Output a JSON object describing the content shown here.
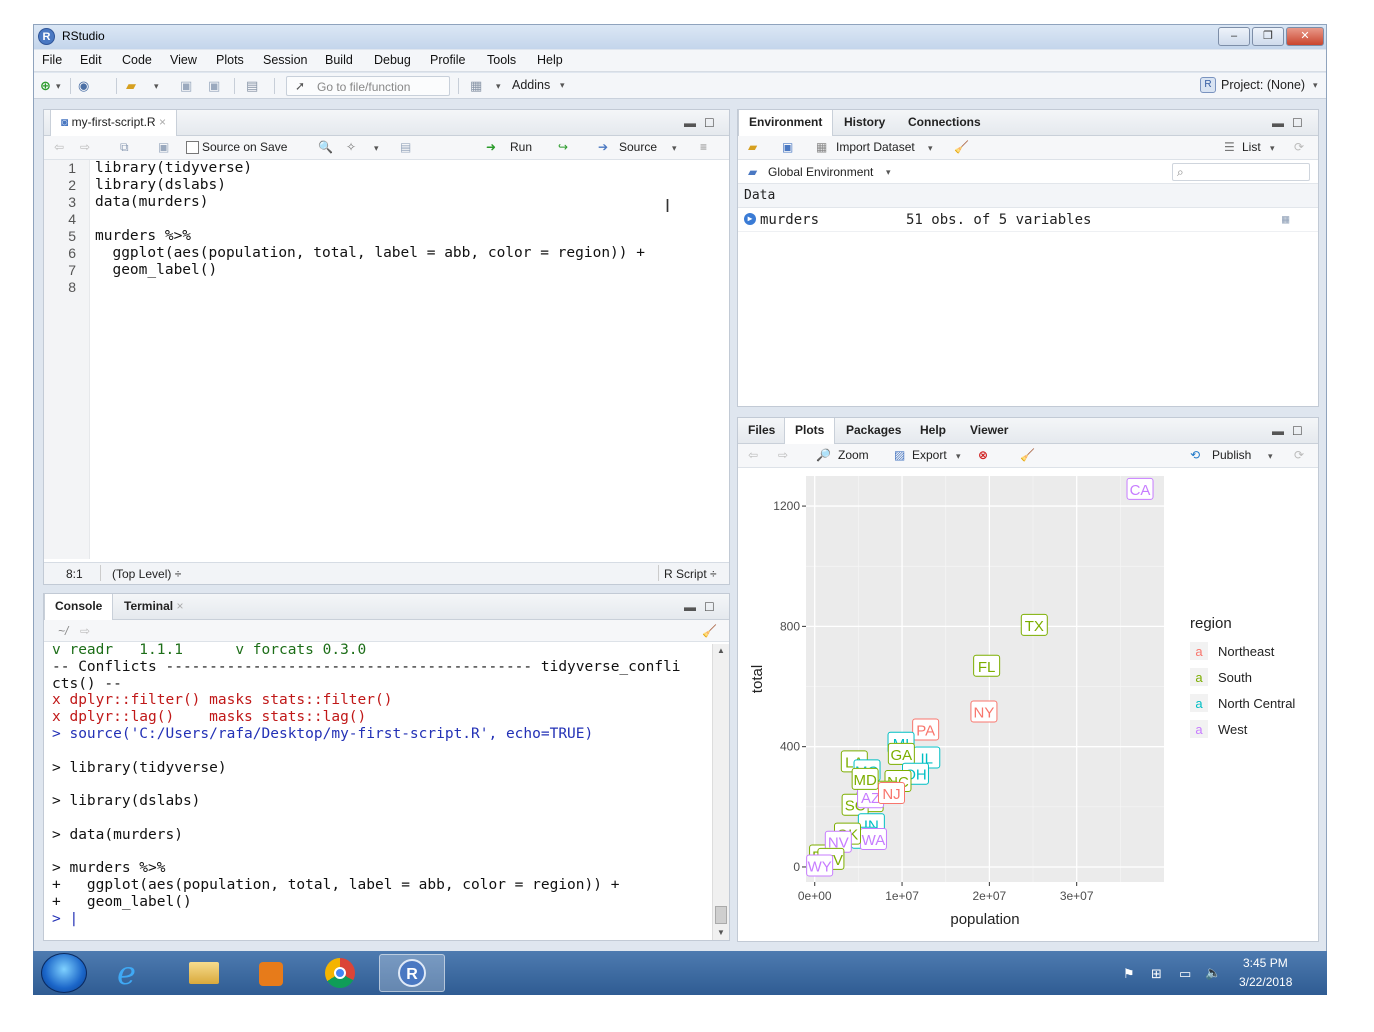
{
  "window": {
    "title": "RStudio"
  },
  "menu": [
    "File",
    "Edit",
    "Code",
    "View",
    "Plots",
    "Session",
    "Build",
    "Debug",
    "Profile",
    "Tools",
    "Help"
  ],
  "toolbar": {
    "goto_placeholder": "Go to file/function",
    "addins": "Addins",
    "project": "Project: (None)"
  },
  "editor": {
    "tab": "my-first-script.R",
    "source_on_save": "Source on Save",
    "run": "Run",
    "source": "Source",
    "lines": [
      "library(tidyverse)",
      "library(dslabs)",
      "data(murders)",
      "",
      "murders %>%",
      "  ggplot(aes(population, total, label = abb, color = region)) +",
      "  geom_label()",
      ""
    ],
    "line_numbers": [
      "1",
      "2",
      "3",
      "4",
      "5",
      "6",
      "7",
      "8"
    ],
    "status_pos": "8:1",
    "status_level": "(Top Level) ÷",
    "status_type": "R Script ÷"
  },
  "console": {
    "tabs": [
      "Console",
      "Terminal"
    ],
    "path": "~/",
    "lines": [
      {
        "t": "v readr   1.1.1      v forcats 0.3.0",
        "c": "cgreen"
      },
      {
        "t": "-- Conflicts ------------------------------------------ tidyverse_confli",
        "c": ""
      },
      {
        "t": "cts() --",
        "c": ""
      },
      {
        "t": "x dplyr::filter() masks stats::filter()",
        "c": "cred"
      },
      {
        "t": "x dplyr::lag()    masks stats::lag()",
        "c": "cred"
      },
      {
        "t": "> source('C:/Users/rafa/Desktop/my-first-script.R', echo=TRUE)",
        "c": "cblue"
      },
      {
        "t": "",
        "c": ""
      },
      {
        "t": "> library(tidyverse)",
        "c": ""
      },
      {
        "t": "",
        "c": ""
      },
      {
        "t": "> library(dslabs)",
        "c": ""
      },
      {
        "t": "",
        "c": ""
      },
      {
        "t": "> data(murders)",
        "c": ""
      },
      {
        "t": "",
        "c": ""
      },
      {
        "t": "> murders %>%",
        "c": ""
      },
      {
        "t": "+   ggplot(aes(population, total, label = abb, color = region)) +",
        "c": ""
      },
      {
        "t": "+   geom_label()",
        "c": ""
      },
      {
        "t": "> |",
        "c": "cblue"
      }
    ]
  },
  "environment": {
    "tabs": [
      "Environment",
      "History",
      "Connections"
    ],
    "import_dataset": "Import Dataset",
    "view_mode": "List",
    "scope": "Global Environment",
    "section": "Data",
    "rows": [
      {
        "name": "murders",
        "value": "51 obs. of 5 variables"
      }
    ]
  },
  "files_pane": {
    "tabs": [
      "Files",
      "Plots",
      "Packages",
      "Help",
      "Viewer"
    ],
    "zoom": "Zoom",
    "export": "Export",
    "publish": "Publish"
  },
  "colors": {
    "Northeast": "#F8766D",
    "South": "#7CAE00",
    "North Central": "#00BFC4",
    "West": "#C77CFF"
  },
  "chart_data": {
    "type": "scatter",
    "xlabel": "population",
    "ylabel": "total",
    "xlim": [
      -1000000,
      40000000
    ],
    "ylim": [
      -50,
      1300
    ],
    "xticks": [
      0,
      10000000,
      20000000,
      30000000
    ],
    "xtick_labels": [
      "0e+00",
      "1e+07",
      "2e+07",
      "3e+07"
    ],
    "yticks": [
      0,
      400,
      800,
      1200
    ],
    "ytick_labels": [
      "0",
      "400",
      "800",
      "1200"
    ],
    "legend_title": "region",
    "legend": [
      "Northeast",
      "South",
      "North Central",
      "West"
    ],
    "points": [
      {
        "label": "CA",
        "region": "West",
        "x": 37253956,
        "y": 1257
      },
      {
        "label": "TX",
        "region": "South",
        "x": 25145561,
        "y": 805
      },
      {
        "label": "FL",
        "region": "South",
        "x": 19687653,
        "y": 669
      },
      {
        "label": "NY",
        "region": "Northeast",
        "x": 19378102,
        "y": 517
      },
      {
        "label": "PA",
        "region": "Northeast",
        "x": 12702379,
        "y": 457
      },
      {
        "label": "MI",
        "region": "North Central",
        "x": 9883640,
        "y": 413
      },
      {
        "label": "IL",
        "region": "North Central",
        "x": 12830632,
        "y": 364
      },
      {
        "label": "GA",
        "region": "South",
        "x": 9920000,
        "y": 376
      },
      {
        "label": "LA",
        "region": "South",
        "x": 4533372,
        "y": 351
      },
      {
        "label": "OH",
        "region": "North Central",
        "x": 11536504,
        "y": 310
      },
      {
        "label": "MO",
        "region": "North Central",
        "x": 5988927,
        "y": 321
      },
      {
        "label": "NC",
        "region": "South",
        "x": 9535483,
        "y": 286
      },
      {
        "label": "VA",
        "region": "South",
        "x": 8001024,
        "y": 250
      },
      {
        "label": "TN",
        "region": "South",
        "x": 6346105,
        "y": 219
      },
      {
        "label": "SC",
        "region": "South",
        "x": 4625364,
        "y": 207
      },
      {
        "label": "AZ",
        "region": "West",
        "x": 6392017,
        "y": 232
      },
      {
        "label": "MD",
        "region": "South",
        "x": 5773552,
        "y": 293
      },
      {
        "label": "NJ",
        "region": "Northeast",
        "x": 8791894,
        "y": 246
      },
      {
        "label": "IN",
        "region": "North Central",
        "x": 6483802,
        "y": 142
      },
      {
        "label": "WI",
        "region": "North Central",
        "x": 5686986,
        "y": 97
      },
      {
        "label": "WA",
        "region": "West",
        "x": 6724540,
        "y": 93
      },
      {
        "label": "OK",
        "region": "South",
        "x": 3751351,
        "y": 111
      },
      {
        "label": "DE",
        "region": "South",
        "x": 897934,
        "y": 38
      },
      {
        "label": "NV",
        "region": "West",
        "x": 2700551,
        "y": 84
      },
      {
        "label": "WV",
        "region": "South",
        "x": 1852994,
        "y": 27
      },
      {
        "label": "WY",
        "region": "West",
        "x": 563626,
        "y": 5
      }
    ]
  },
  "taskbar": {
    "time": "3:45 PM",
    "date": "3/22/2018"
  }
}
